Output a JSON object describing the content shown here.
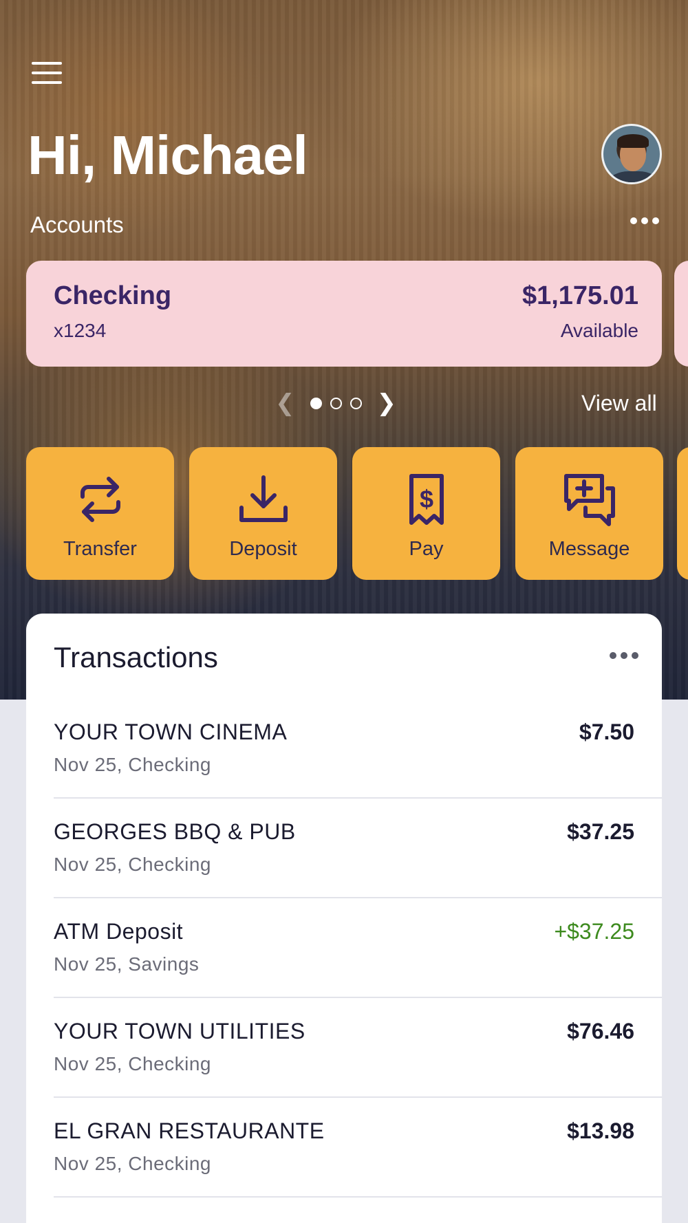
{
  "header": {
    "greeting": "Hi, Michael",
    "accounts_label": "Accounts"
  },
  "account_card": {
    "name": "Checking",
    "number": "x1234",
    "balance": "$1,175.01",
    "balance_label": "Available"
  },
  "pager": {
    "view_all": "View all",
    "pages": 3,
    "active_page": 1
  },
  "actions": [
    {
      "label": "Transfer",
      "icon": "transfer-icon"
    },
    {
      "label": "Deposit",
      "icon": "deposit-icon"
    },
    {
      "label": "Pay",
      "icon": "pay-icon"
    },
    {
      "label": "Message",
      "icon": "message-icon"
    }
  ],
  "transactions": {
    "title": "Transactions",
    "items": [
      {
        "merchant": "YOUR TOWN CINEMA",
        "meta": "Nov 25, Checking",
        "amount": "$7.50"
      },
      {
        "merchant": "GEORGES BBQ & PUB",
        "meta": "Nov 25, Checking",
        "amount": "$37.25"
      },
      {
        "merchant": "ATM Deposit",
        "meta": "Nov 25, Savings",
        "amount": "+$37.25"
      },
      {
        "merchant": "YOUR TOWN UTILITIES",
        "meta": "Nov 25, Checking",
        "amount": "$76.46"
      },
      {
        "merchant": "EL GRAN RESTAURANTE",
        "meta": "Nov 25, Checking",
        "amount": "$13.98"
      }
    ]
  },
  "colors": {
    "card_pink": "#f8d3d9",
    "action_orange": "#f6b23f",
    "brand_purple": "#3a2566",
    "credit_green": "#3d8a1e"
  }
}
